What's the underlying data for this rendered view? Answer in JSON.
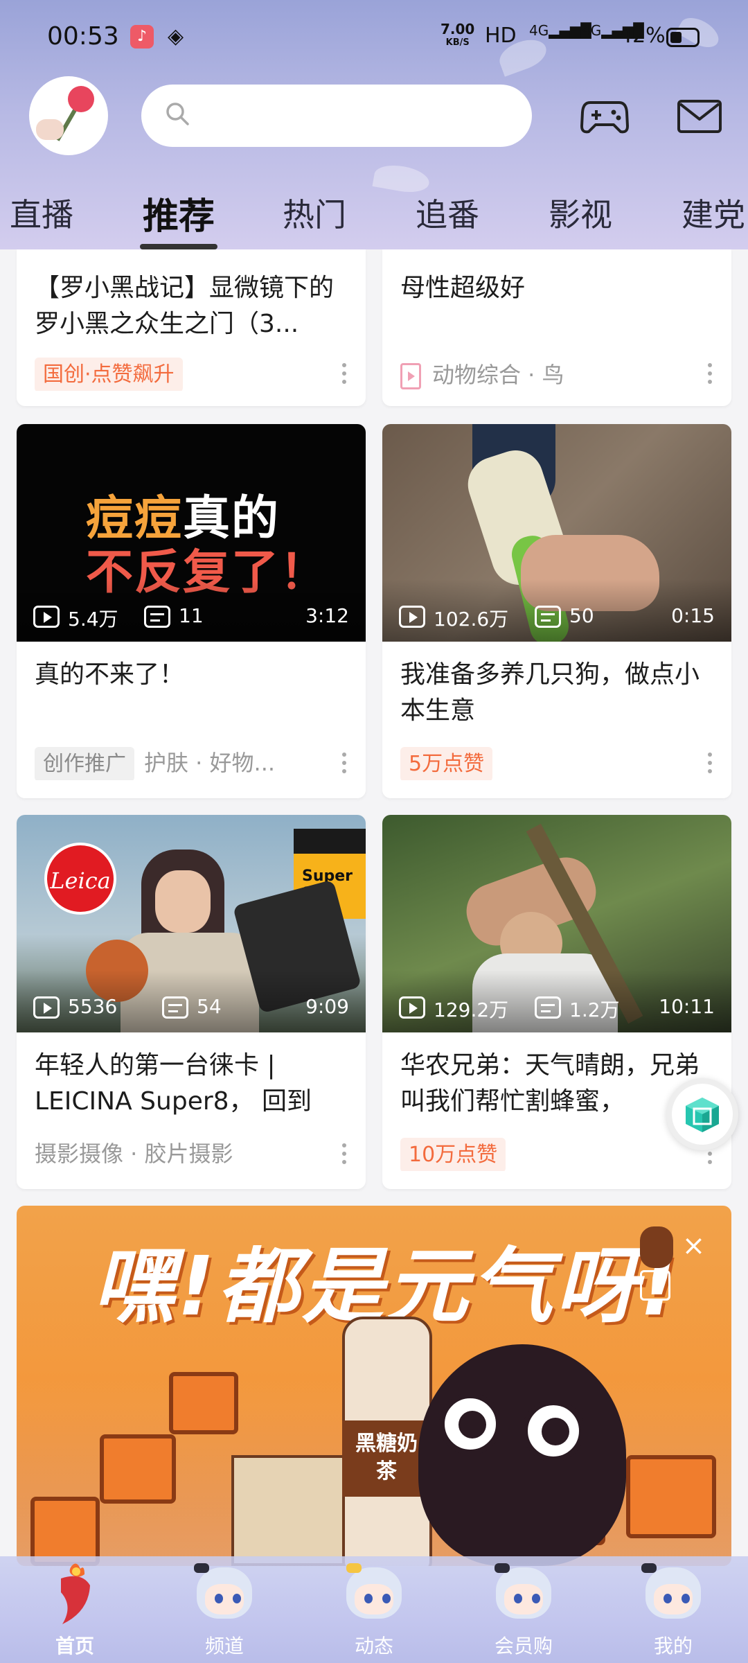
{
  "status_bar": {
    "time": "00:53",
    "net_speed_value": "7.00",
    "net_speed_unit": "KB/S",
    "hd_label": "HD",
    "signal1": "4G",
    "signal2": "4G",
    "battery": "42%"
  },
  "header": {
    "search_placeholder": "",
    "tabs": [
      {
        "label": "直播",
        "active": false
      },
      {
        "label": "推荐",
        "active": true
      },
      {
        "label": "热门",
        "active": false
      },
      {
        "label": "追番",
        "active": false
      },
      {
        "label": "影视",
        "active": false
      },
      {
        "label": "建党",
        "active": false
      }
    ]
  },
  "feed": {
    "cards": [
      {
        "title": "【罗小黑战记】显微镜下的罗小黑之众生之门（3...",
        "badge": "国创·点赞飙升",
        "meta": ""
      },
      {
        "title": "母性超级好",
        "badge": "",
        "meta": "动物综合 · 鸟"
      },
      {
        "thumb_line1a": "痘痘",
        "thumb_line1b": "真的",
        "thumb_line2": "不反复了！",
        "views": "5.4万",
        "danmaku": "11",
        "duration": "3:12",
        "title": "真的不来了！",
        "badge": "创作推广",
        "meta": "护肤 · 好物..."
      },
      {
        "views": "102.6万",
        "danmaku": "50",
        "duration": "0:15",
        "title": "我准备多养几只狗，做点小本生意",
        "badge": "5万点赞",
        "meta": ""
      },
      {
        "thumb_logo": "Leica",
        "thumb_tag1": "Super 8",
        "views": "5536",
        "danmaku": "54",
        "duration": "9:09",
        "title": "年轻人的第一台徕卡 | LEICINA Super8， 回到1...",
        "badge": "",
        "meta": "摄影摄像 · 胶片摄影"
      },
      {
        "views": "129.2万",
        "danmaku": "1.2万",
        "duration": "10:11",
        "title": "华农兄弟：天气晴朗，兄弟叫我们帮忙割蜂蜜，",
        "badge": "10万点赞",
        "meta": ""
      }
    ]
  },
  "ad": {
    "headline": "嘿!都是元气呀!",
    "bottle_text": "黑糖奶茶",
    "partner_mark": "×"
  },
  "bottom_nav": [
    {
      "label": "首页",
      "active": true
    },
    {
      "label": "频道",
      "active": false
    },
    {
      "label": "动态",
      "active": false
    },
    {
      "label": "会员购",
      "active": false
    },
    {
      "label": "我的",
      "active": false
    }
  ],
  "colors": {
    "header_gradient_top": "#9aa3d8",
    "badge_orange_text": "#f36b3d",
    "badge_orange_bg": "#fdeee9",
    "ad_orange": "#f2a24a"
  }
}
